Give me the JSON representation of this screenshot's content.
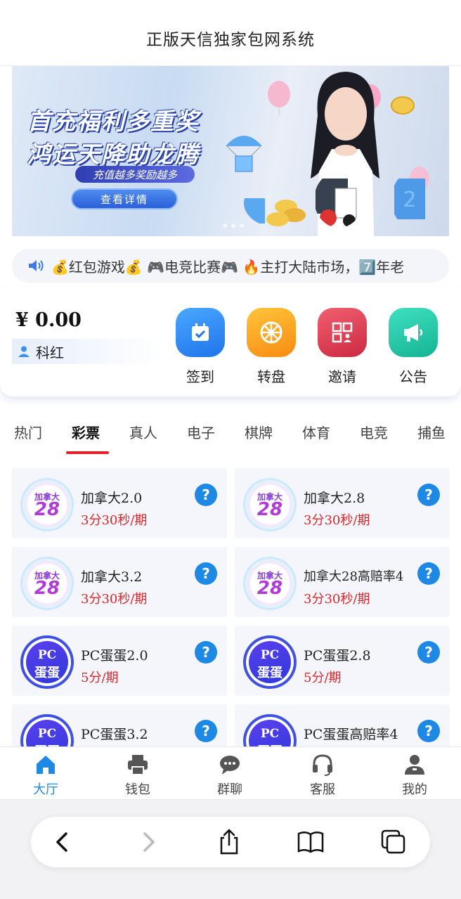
{
  "header": {
    "title": "正版天信独家包网系统"
  },
  "banner": {
    "line1": "首充福利多重奖",
    "line2": "鸿运天降助龙腾",
    "subtitle": "充值越多奖励越多",
    "button_label": "查看详情"
  },
  "marquee": {
    "text": "💰红包游戏💰 🎮电竞比赛🎮 🔥主打大陆市场，7️⃣年老"
  },
  "wallet": {
    "balance": "¥ 0.00",
    "username": "科红",
    "actions": [
      {
        "label": "签到",
        "icon": "calendar-check-icon",
        "color": "#2f8cf6"
      },
      {
        "label": "转盘",
        "icon": "wheel-icon",
        "color": "#f7a21b"
      },
      {
        "label": "邀请",
        "icon": "qr-invite-icon",
        "color": "#e03a52"
      },
      {
        "label": "公告",
        "icon": "megaphone-icon",
        "color": "#22c6a6"
      }
    ]
  },
  "tabs": {
    "items": [
      "热门",
      "彩票",
      "真人",
      "电子",
      "棋牌",
      "体育",
      "电竞",
      "捕鱼"
    ],
    "active_index": 1,
    "accent": "#e2232a"
  },
  "games": [
    {
      "name": "加拿大2.0",
      "period": "3分30秒/期",
      "logo": "canada28",
      "logo_top": "加拿大",
      "logo_bottom": "28"
    },
    {
      "name": "加拿大2.8",
      "period": "3分30秒/期",
      "logo": "canada28",
      "logo_top": "加拿大",
      "logo_bottom": "28"
    },
    {
      "name": "加拿大3.2",
      "period": "3分30秒/期",
      "logo": "canada28",
      "logo_top": "加拿大",
      "logo_bottom": "28"
    },
    {
      "name": "加拿大28高赔率4",
      "period": "3分30秒/期",
      "logo": "canada28",
      "logo_top": "加拿大",
      "logo_bottom": "28"
    },
    {
      "name": "PC蛋蛋2.0",
      "period": "5分/期",
      "logo": "pcdandan",
      "logo_top": "PC",
      "logo_bottom": "蛋蛋"
    },
    {
      "name": "PC蛋蛋2.8",
      "period": "5分/期",
      "logo": "pcdandan",
      "logo_top": "PC",
      "logo_bottom": "蛋蛋"
    },
    {
      "name": "PC蛋蛋3.2",
      "period": "",
      "logo": "pcdandan",
      "logo_top": "PC",
      "logo_bottom": "蛋蛋"
    },
    {
      "name": "PC蛋蛋高赔率4",
      "period": "",
      "logo": "pcdandan",
      "logo_top": "PC",
      "logo_bottom": "蛋蛋"
    }
  ],
  "help_label": "?",
  "bottom_nav": {
    "items": [
      {
        "label": "大厅",
        "icon": "home-icon"
      },
      {
        "label": "钱包",
        "icon": "printer-wallet-icon"
      },
      {
        "label": "群聊",
        "icon": "chat-bubble-icon"
      },
      {
        "label": "客服",
        "icon": "headset-icon"
      },
      {
        "label": "我的",
        "icon": "user-icon"
      }
    ],
    "active_index": 0,
    "active_color": "#1e88e5"
  },
  "browser_toolbar": {
    "buttons": [
      "back-icon",
      "forward-icon",
      "share-icon",
      "bookmarks-icon",
      "tabs-icon"
    ]
  }
}
